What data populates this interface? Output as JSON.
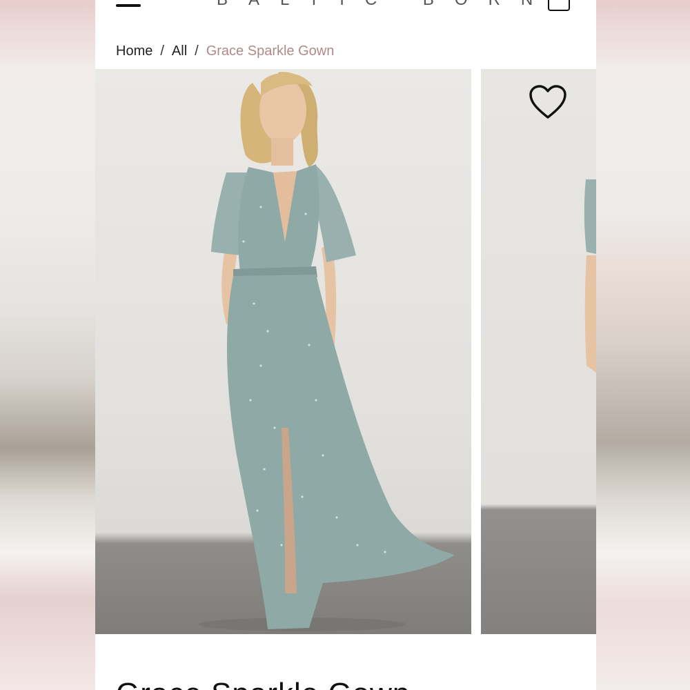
{
  "header": {
    "brand": "BALTIC BORN",
    "menu_icon": "hamburger-menu-icon",
    "cart_icon": "shopping-bag-icon"
  },
  "breadcrumb": {
    "items": [
      "Home",
      "All"
    ],
    "separator": "/",
    "current": "Grace Sparkle Gown"
  },
  "gallery": {
    "favorite_icon": "heart-icon"
  },
  "product": {
    "title": "Grace Sparkle Gown"
  },
  "colors": {
    "breadcrumb_current": "#b08a8a",
    "dress": "#8fa9a6"
  }
}
